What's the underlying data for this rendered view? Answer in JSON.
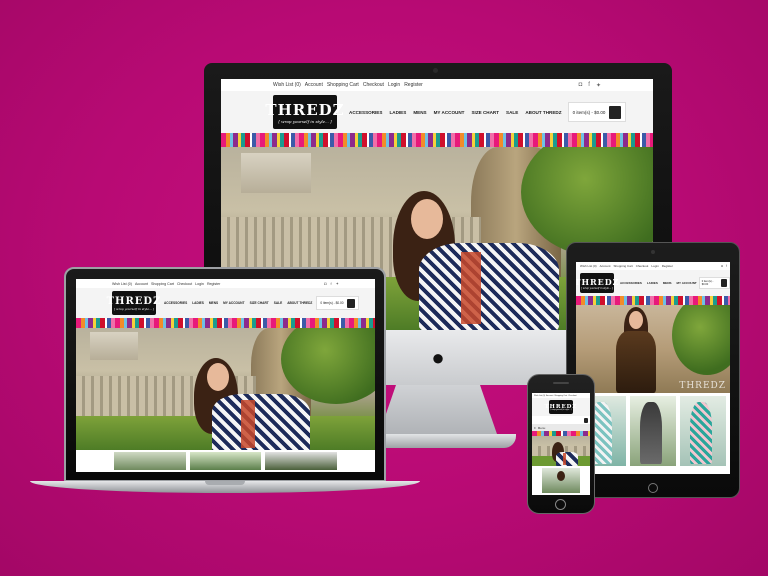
{
  "brand": {
    "logo_text": "THREDZ",
    "tagline": "[ wrap yourself in style... ]",
    "hero_watermark": "THREDZ"
  },
  "topbar": {
    "wishlist": "Wish List (0)",
    "account": "Account",
    "cart": "Shopping Cart",
    "checkout": "Checkout",
    "login": "Login",
    "register": "Register",
    "social_icons": [
      "instagram-icon",
      "facebook-icon",
      "twitter-icon"
    ]
  },
  "nav": {
    "items": [
      "ACCESSORIES",
      "LADIES",
      "MENS",
      "MY ACCOUNT",
      "SIZE CHART",
      "SALE",
      "ABOUT THREDZ"
    ]
  },
  "cart_summary": {
    "text": "0 item(s) - $0.00",
    "text_short": "0 item(s) - $0.00"
  },
  "phone": {
    "menu_label": "Menu"
  },
  "colors": {
    "background": "#b80a74",
    "accent_stripe": [
      "#e8197a",
      "#f28c28",
      "#6ec1e4",
      "#8d2a8c",
      "#f5d13b",
      "#1b9c8f"
    ]
  }
}
